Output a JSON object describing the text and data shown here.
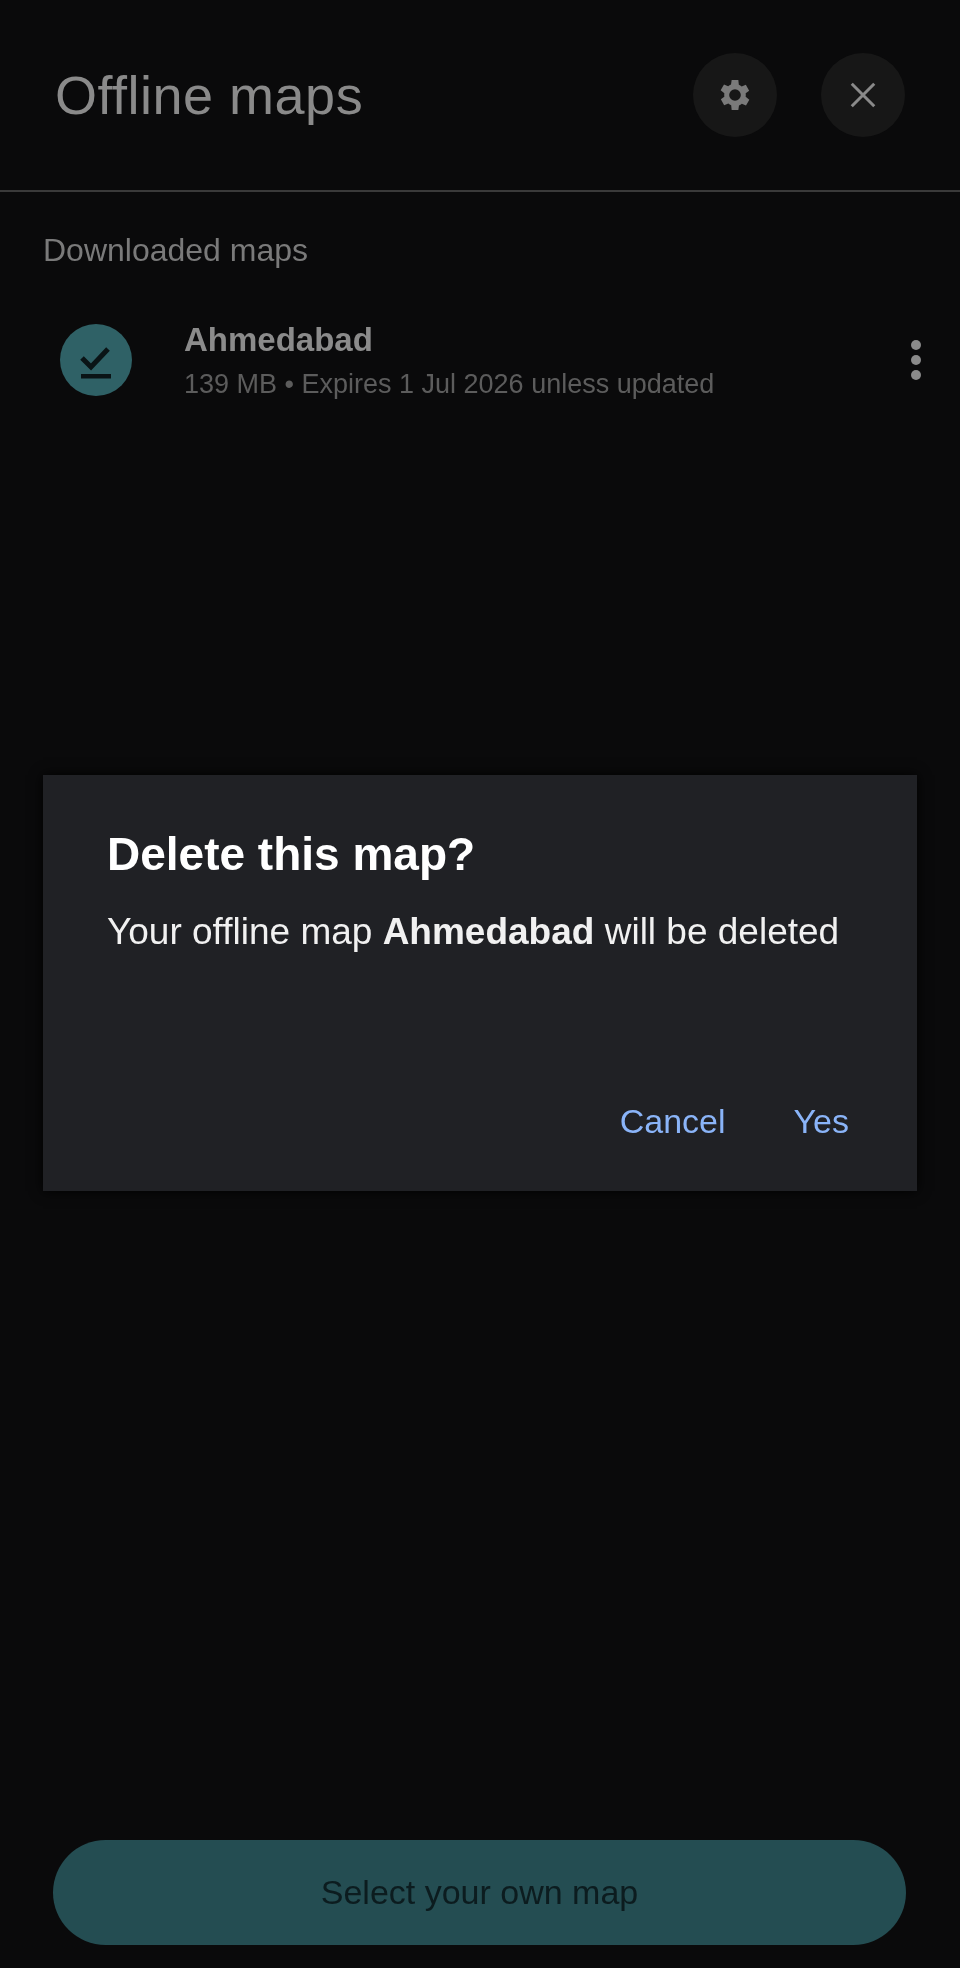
{
  "header": {
    "title": "Offline maps"
  },
  "section": {
    "title": "Downloaded maps"
  },
  "maps": [
    {
      "name": "Ahmedabad",
      "details": "139 MB • Expires 1 Jul 2026 unless updated"
    }
  ],
  "dialog": {
    "title": "Delete this map?",
    "message": "Your offline map **Ahmedabad** will be deleted",
    "buttons": [
      "Cancel",
      "Yes"
    ]
  },
  "bottom_button": {
    "label": "Select your own map"
  }
}
